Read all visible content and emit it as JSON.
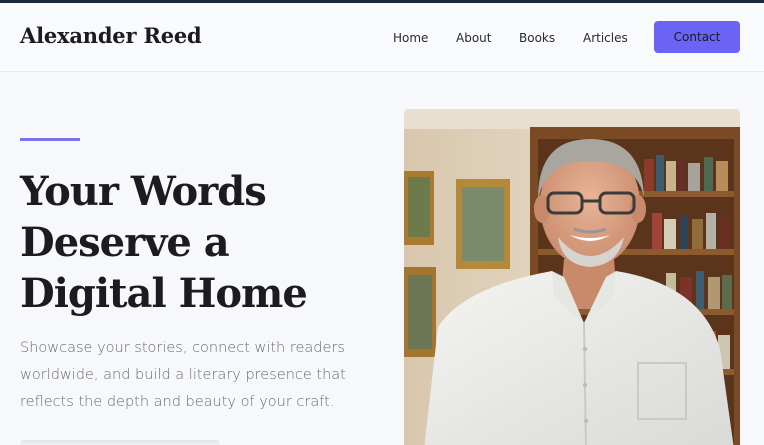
{
  "header": {
    "brand": "Alexander Reed",
    "nav": [
      "Home",
      "About",
      "Books",
      "Articles"
    ],
    "cta": "Contact"
  },
  "hero": {
    "title": "Your Words Deserve a Digital Home",
    "subtitle": "Showcase your stories, connect with readers worldwide, and build a literary presence that reflects the depth and beauty of your craft."
  },
  "colors": {
    "accent": "#6b63f5",
    "heading": "#1c1c1f",
    "body_text": "#6b6c74",
    "background": "#f7f8fb"
  }
}
